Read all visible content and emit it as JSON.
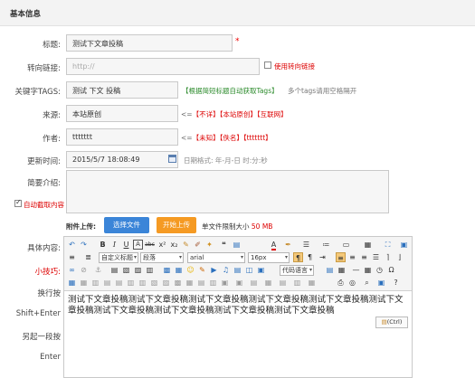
{
  "section": {
    "title": "基本信息"
  },
  "form": {
    "title": {
      "label": "标题:",
      "value": "测试下文章投稿",
      "required_mark": "*"
    },
    "redirect": {
      "label": "转向链接:",
      "placeholder": "http://",
      "option_label": "使用转向链接"
    },
    "tags": {
      "label": "关键字TAGS:",
      "value": "测试 下文 投稿",
      "auto_link": "【根据简短标题自动获取Tags】",
      "note": "多个tags请用空格隔开"
    },
    "source": {
      "label": "来源:",
      "value": "本站原创",
      "prefix": "<=",
      "options": [
        "【不详】",
        "【本站原创】",
        "【互联网】"
      ]
    },
    "author": {
      "label": "作者:",
      "value": "ttttttt",
      "prefix": "<=",
      "options": [
        "【未知】",
        "【佚名】",
        "【ttttttt】"
      ]
    },
    "update_time": {
      "label": "更新时间:",
      "value": "2015/5/7 18:08:49",
      "format_hint": "日期格式: 年-月-日 时:分:秒"
    },
    "summary": {
      "label": "简要介绍:",
      "auto_extract_label": "自动截取内容"
    },
    "attachment": {
      "label": "附件上传:",
      "select_button": "选择文件",
      "upload_button": "开始上传",
      "limit_prefix": "单文件限制大小",
      "limit_value": "50 MB"
    },
    "content": {
      "label": "具体内容:",
      "tips_label": "小技巧:",
      "tips": [
        "换行按",
        "Shift+Enter",
        "另起一段按",
        "Enter"
      ]
    }
  },
  "editor": {
    "paragraph_select": "段落",
    "custom_title_select": "自定义标题",
    "font_select": "arial",
    "size_select": "16px",
    "code_select": "代码语言",
    "paste_button": "(Ctrl)",
    "body_text": "测试下文章投稿测试下文章投稿测试下文章投稿测试下文章投稿测试下文章投稿测试下文章投稿测试下文章投稿测试下文章投稿测试下文章投稿测试下文章投稿"
  },
  "colors": {
    "accent_blue": "#3b85d8",
    "accent_orange": "#f59a23",
    "required_red": "#e00000",
    "link_green": "#2a8a2a"
  }
}
